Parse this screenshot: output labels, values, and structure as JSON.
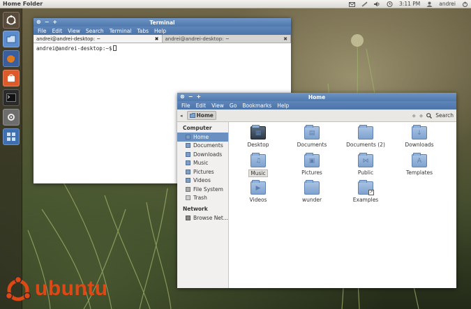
{
  "top_panel": {
    "title": "Home Folder",
    "clock": "3:11 PM",
    "user": "andrei"
  },
  "launcher": {
    "items": [
      {
        "name": "dash-home-icon",
        "color": "#e05a1e"
      },
      {
        "name": "home-folder-icon",
        "color": "#5b8dce"
      },
      {
        "name": "firefox-icon",
        "color": "#e07a1e"
      },
      {
        "name": "software-center-icon",
        "color": "#dd5a2a"
      },
      {
        "name": "terminal-icon",
        "color": "#2b2b2b"
      },
      {
        "name": "system-settings-icon",
        "color": "#6d6d6d"
      },
      {
        "name": "workspace-switcher-icon",
        "color": "#3e6fb0"
      }
    ]
  },
  "terminal": {
    "title": "Terminal",
    "menu": [
      "File",
      "Edit",
      "View",
      "Search",
      "Terminal",
      "Tabs",
      "Help"
    ],
    "tabs": [
      {
        "label": "andrei@andrei-desktop: ~"
      },
      {
        "label": "andrei@andrei-desktop: ~"
      }
    ],
    "prompt": "andrei@andrei-desktop:~$"
  },
  "files": {
    "title": "Home",
    "menu": [
      "File",
      "Edit",
      "View",
      "Go",
      "Bookmarks",
      "Help"
    ],
    "location": "Home",
    "search_label": "Search",
    "sidebar": {
      "computer_heading": "Computer",
      "computer_items": [
        "Home",
        "Documents",
        "Downloads",
        "Music",
        "Pictures",
        "Videos",
        "File System",
        "Trash"
      ],
      "network_heading": "Network",
      "network_items": [
        "Browse Net..."
      ]
    },
    "items": [
      "Desktop",
      "Documents",
      "Documents (2)",
      "Downloads",
      "Music",
      "Pictures",
      "Public",
      "Templates",
      "Videos",
      "wunder",
      "Examples"
    ]
  },
  "branding": {
    "wordmark": "ubuntu",
    "accent": "#dd4814"
  }
}
